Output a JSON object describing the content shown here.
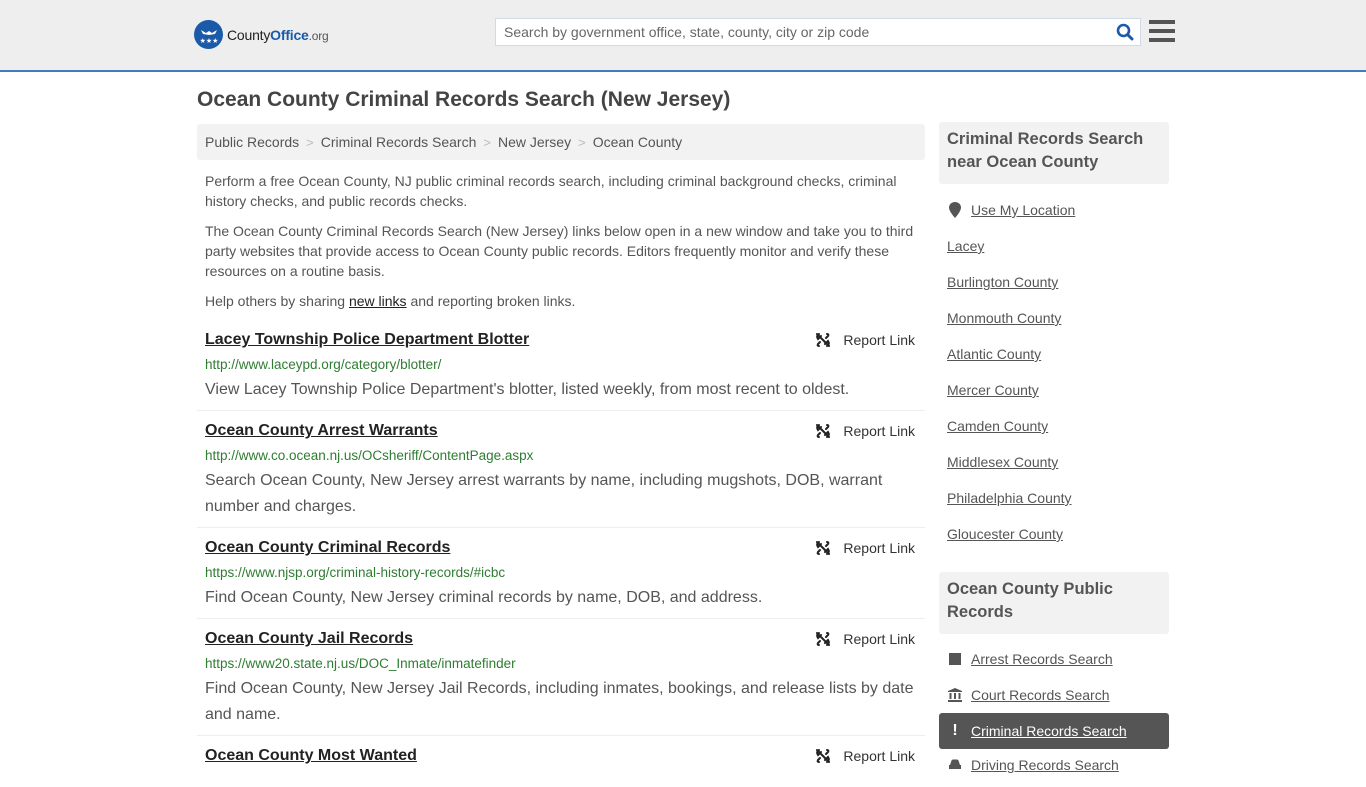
{
  "header": {
    "logo": {
      "county": "County",
      "office": "Office",
      "org": ".org"
    },
    "search": {
      "placeholder": "Search by government office, state, county, city or zip code",
      "value": ""
    },
    "colors": {
      "brand": "#1b5aa8",
      "accent_border": "#3e7dbb"
    }
  },
  "page": {
    "title": "Ocean County Criminal Records Search (New Jersey)",
    "breadcrumb": [
      "Public Records",
      "Criminal Records Search",
      "New Jersey",
      "Ocean County"
    ],
    "intro": [
      "Perform a free Ocean County, NJ public criminal records search, including criminal background checks, criminal history checks, and public records checks.",
      "The Ocean County Criminal Records Search (New Jersey) links below open in a new window and take you to third party websites that provide access to Ocean County public records. Editors frequently monitor and verify these resources on a routine basis."
    ],
    "help": {
      "before": "Help others by sharing ",
      "link": "new links",
      "after": " and reporting broken links."
    }
  },
  "listings": [
    {
      "title": "Lacey Township Police Department Blotter",
      "url": "http://www.laceypd.org/category/blotter/",
      "description": "View Lacey Township Police Department's blotter, listed weekly, from most recent to oldest.",
      "report": "Report Link"
    },
    {
      "title": "Ocean County Arrest Warrants",
      "url": "http://www.co.ocean.nj.us/OCsheriff/ContentPage.aspx",
      "description": "Search Ocean County, New Jersey arrest warrants by name, including mugshots, DOB, warrant number and charges.",
      "report": "Report Link"
    },
    {
      "title": "Ocean County Criminal Records",
      "url": "https://www.njsp.org/criminal-history-records/#icbc",
      "description": "Find Ocean County, New Jersey criminal records by name, DOB, and address.",
      "report": "Report Link"
    },
    {
      "title": "Ocean County Jail Records",
      "url": "https://www20.state.nj.us/DOC_Inmate/inmatefinder",
      "description": "Find Ocean County, New Jersey Jail Records, including inmates, bookings, and release lists by date and name.",
      "report": "Report Link"
    },
    {
      "title": "Ocean County Most Wanted",
      "url": "",
      "description": "",
      "report": "Report Link"
    }
  ],
  "sidebar": {
    "nearby": {
      "heading": "Criminal Records Search near Ocean County",
      "use_location": "Use My Location",
      "items": [
        "Lacey",
        "Burlington County",
        "Monmouth County",
        "Atlantic County",
        "Mercer County",
        "Camden County",
        "Middlesex County",
        "Philadelphia County",
        "Gloucester County"
      ]
    },
    "public_records": {
      "heading": "Ocean County Public Records",
      "items": [
        {
          "label": "Arrest Records Search",
          "icon": "square-icon",
          "active": false
        },
        {
          "label": "Court Records Search",
          "icon": "courthouse-icon",
          "active": false
        },
        {
          "label": "Criminal Records Search",
          "icon": "exclamation-icon",
          "active": true
        },
        {
          "label": "Driving Records Search",
          "icon": "car-icon",
          "active": false
        }
      ]
    }
  }
}
